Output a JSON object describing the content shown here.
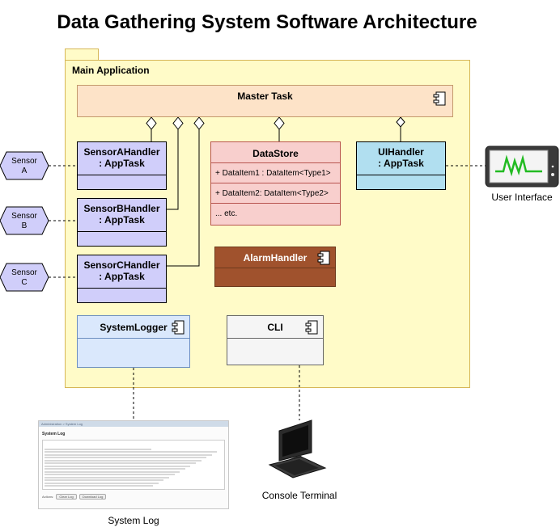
{
  "title": "Data Gathering System Software Architecture",
  "package": {
    "label": "Main Application"
  },
  "master_task": {
    "label": "Master Task",
    "icon": "component-icon"
  },
  "handlers": [
    {
      "name": "SensorAHandler",
      "type": ": AppTask"
    },
    {
      "name": "SensorBHandler",
      "type": ": AppTask"
    },
    {
      "name": "SensorCHandler",
      "type": ": AppTask"
    }
  ],
  "sensors": [
    {
      "line1": "Sensor",
      "line2": "A"
    },
    {
      "line1": "Sensor",
      "line2": "B"
    },
    {
      "line1": "Sensor",
      "line2": "C"
    }
  ],
  "datastore": {
    "title": "DataStore",
    "rows": [
      "+ DataItem1 : DataItem<Type1>",
      "+ DataItem2: DataItem<Type2>",
      "... etc."
    ]
  },
  "ui_handler": {
    "name": "UIHandler",
    "type": ": AppTask"
  },
  "alarm_handler": {
    "label": "AlarmHandler",
    "icon": "component-icon"
  },
  "system_logger": {
    "label": "SystemLogger",
    "icon": "component-icon"
  },
  "cli": {
    "label": "CLI",
    "icon": "component-icon"
  },
  "external": {
    "user_interface": "User Interface",
    "console_terminal": "Console Terminal",
    "system_log": "System Log"
  },
  "log_screenshot": {
    "window_bar": "Administration > System Log",
    "heading": "System Log",
    "buttons": [
      "Clear Log",
      "Download Log"
    ],
    "footer_prefix": "Actions:"
  },
  "colors": {
    "package_fill": "#fffbc8",
    "master_fill": "#fde3c8",
    "handler_fill": "#d0cefa",
    "ui_fill": "#b1dff0",
    "datastore_fill": "#f8cfcd",
    "alarm_fill": "#a0522d",
    "logger_fill": "#dae8fc",
    "cli_fill": "#f5f5f5",
    "sensor_fill": "#d0cefa"
  }
}
